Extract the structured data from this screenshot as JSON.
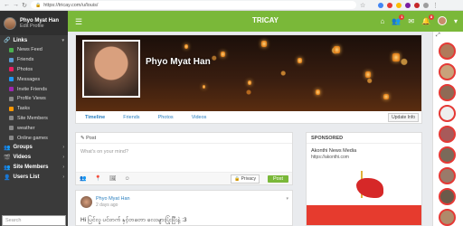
{
  "browser": {
    "url": "https://tricay.com/u/louis/",
    "back_icon": "arrow-left-icon",
    "forward_icon": "arrow-right-icon",
    "reload_icon": "reload-icon",
    "star_icon": "star-icon",
    "menu_icon": "more-vert-icon"
  },
  "sidebar": {
    "profile": {
      "name": "Phyo Myat Han",
      "edit": "Edit Profile"
    },
    "links_header": "Links",
    "items": [
      {
        "label": "News Feed",
        "icon": "newsfeed-icon",
        "color": "#4caf50"
      },
      {
        "label": "Friends",
        "icon": "friends-icon",
        "color": "#5c9bd1"
      },
      {
        "label": "Photos",
        "icon": "photos-icon",
        "color": "#e91e63"
      },
      {
        "label": "Messages",
        "icon": "messages-icon",
        "color": "#2196f3"
      },
      {
        "label": "Invite Friends",
        "icon": "invite-icon",
        "color": "#9c27b0"
      },
      {
        "label": "Profile Views",
        "icon": "chevron-right-icon",
        "color": "#888888"
      },
      {
        "label": "Tasks",
        "icon": "tasks-icon",
        "color": "#ff9800"
      },
      {
        "label": "Site Members",
        "icon": "chevron-right-icon",
        "color": "#888888"
      },
      {
        "label": "weather",
        "icon": "chevron-right-icon",
        "color": "#888888"
      },
      {
        "label": "Online games",
        "icon": "chevron-right-icon",
        "color": "#888888"
      }
    ],
    "sections": [
      "Groups",
      "Videos",
      "Site Members",
      "Users List"
    ],
    "search_placeholder": "Search"
  },
  "topbar": {
    "brand": "TRICAY",
    "menu_icon": "hamburger-icon",
    "home_icon": "home-icon",
    "friends_badge": "1",
    "messages_icon": "envelope-icon",
    "notifications_badge": "8",
    "accent": "#7ab839"
  },
  "cover": {
    "name": "Phyo Myat Han",
    "tabs": [
      "Timeline",
      "Friends",
      "Photos",
      "Videos"
    ],
    "update_button": "Update Info"
  },
  "composer": {
    "header": "Post",
    "placeholder": "What's on your mind?",
    "privacy": "Privacy",
    "post_button": "Post"
  },
  "post": {
    "author": "Phyo Myat Han",
    "time": "2 days ago",
    "content": "Hi ပြင်လူ ပင်တက် နှင့်တတော လေးများပြုံးပြီးနဲ့ :3"
  },
  "sponsored": {
    "header": "SPONSORED",
    "title": "Akonthi News Media",
    "url": "https://akonthi.com"
  },
  "online": {
    "header_icon": "expand-icon",
    "count": 9
  }
}
